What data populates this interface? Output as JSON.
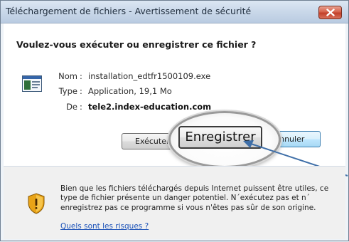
{
  "window": {
    "title": "Téléchargement de fichiers - Avertissement de sécurité",
    "close_icon": "close-icon"
  },
  "prompt": {
    "question": "Voulez-vous exécuter ou enregistrer ce fichier ?"
  },
  "file_info": {
    "icon": "application-file-icon",
    "rows": [
      {
        "label": "Nom",
        "value": "installation_edtfr1500109.exe"
      },
      {
        "label": "Type",
        "value": "Application, 19,1 Mo"
      },
      {
        "label": "De",
        "value": "tele2.index-education.com"
      }
    ]
  },
  "buttons": {
    "execute_label": "Exécuter",
    "save_label": "Enregistrer",
    "cancel_label": "Annuler"
  },
  "warning": {
    "icon": "shield-warning-icon",
    "lines": [
      "Bien que les fichiers téléchargés depuis Internet puissent être utiles, ce",
      "type de fichier présente un danger potentiel. N´exécutez pas et n´",
      "enregistrez pas ce programme si vous n'êtes pas sûr de son origine."
    ],
    "link": "Quels sont les risques ?"
  },
  "colors": {
    "link": "#1c52b8",
    "arrow": "#3f6fa8",
    "close_button": "#c2402a"
  }
}
